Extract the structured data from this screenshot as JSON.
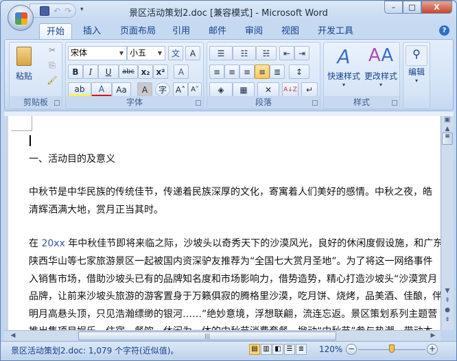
{
  "window": {
    "title": "景区活动策划2.doc [兼容模式] - Microsoft Word",
    "minimize": "–",
    "restore": "□",
    "close": "X"
  },
  "qat": {
    "undo": "↶",
    "redo": "↷",
    "more": "▾"
  },
  "tabs": [
    {
      "label": "开始"
    },
    {
      "label": "插入"
    },
    {
      "label": "页面布局"
    },
    {
      "label": "引用"
    },
    {
      "label": "邮件"
    },
    {
      "label": "审阅"
    },
    {
      "label": "视图"
    },
    {
      "label": "开发工具"
    }
  ],
  "help": "?",
  "ribbon": {
    "clipboard": {
      "label": "剪贴板",
      "paste": "粘贴",
      "cut": "✂",
      "copy": "⎘",
      "format_painter": "🖌"
    },
    "font": {
      "label": "字体",
      "font_name": "宋体",
      "font_size": "小五",
      "phonetic": "文",
      "border": "A",
      "bold": "B",
      "italic": "I",
      "underline": "U",
      "strike": "abc",
      "sub": "x₂",
      "sup": "x²",
      "clear": "A",
      "highlight": "ab",
      "color": "A",
      "case": "Aa",
      "shade": "A",
      "enclose": "字",
      "grow": "A˄",
      "shrink": "A˅"
    },
    "paragraph": {
      "label": "段落",
      "bullets": "☰",
      "numbering": "☷",
      "multilevel": "☵",
      "dec_indent": "⇤",
      "inc_indent": "⇥",
      "left": "≡",
      "center": "≡",
      "right": "≡",
      "justify": "≡",
      "distributed": "≣",
      "spacing": "↕",
      "shading": "◈",
      "borders": "▦",
      "asian": "✕",
      "sort": "A↓Z",
      "marks": "↵"
    },
    "styles": {
      "label": "样式",
      "quick": "快速样式",
      "change": "更改样式"
    },
    "editing": {
      "label": "编辑",
      "icon": "⚲"
    }
  },
  "document": {
    "lines": [
      "一、活动目的及意义",
      "中秋节是中华民族的传统佳节，传递着民族深厚的文化，寄寓着人们美好的感情。中秋之夜，皓",
      "清辉洒满大地，赏月正当其时。",
      "年中秋佳节即将来临之际，沙坡头以奇秀天下的沙漠风光，良好的休闲度假设施，和广东",
      "陕西华山等七家旅游景区一起被国内资深驴友推荐为“全国七大赏月圣地”。为了将这一网络事件",
      "入销售市场，借助沙坡头已有的品牌知名度和市场影响力，借势造势，精心打造沙坡头“沙漠赏月",
      "品牌，让前来沙坡头旅游的游客置身于万籁俱寂的腾格里沙漠，吃月饼、烧烤，品美酒、佳酿，伴",
      "明月高悬头顶，只见浩瀚缥缈的银河……”绝妙意境，浮想联翩，流连忘返。景区策划系列主题营",
      "推出集项目娱乐、住宿、餐饮、休闲为一体的中秋节消费套餐，掀动“中秋节”参与热潮，带动本"
    ],
    "line3_prefix": "在 ",
    "line3_year": "20xx"
  },
  "status": {
    "text": "景区活动策划2.doc: 1,079 个字符(近似值)。",
    "zoom": "120%",
    "zoom_out": "−",
    "zoom_in": "+",
    "zoom_level_percent": 120
  }
}
